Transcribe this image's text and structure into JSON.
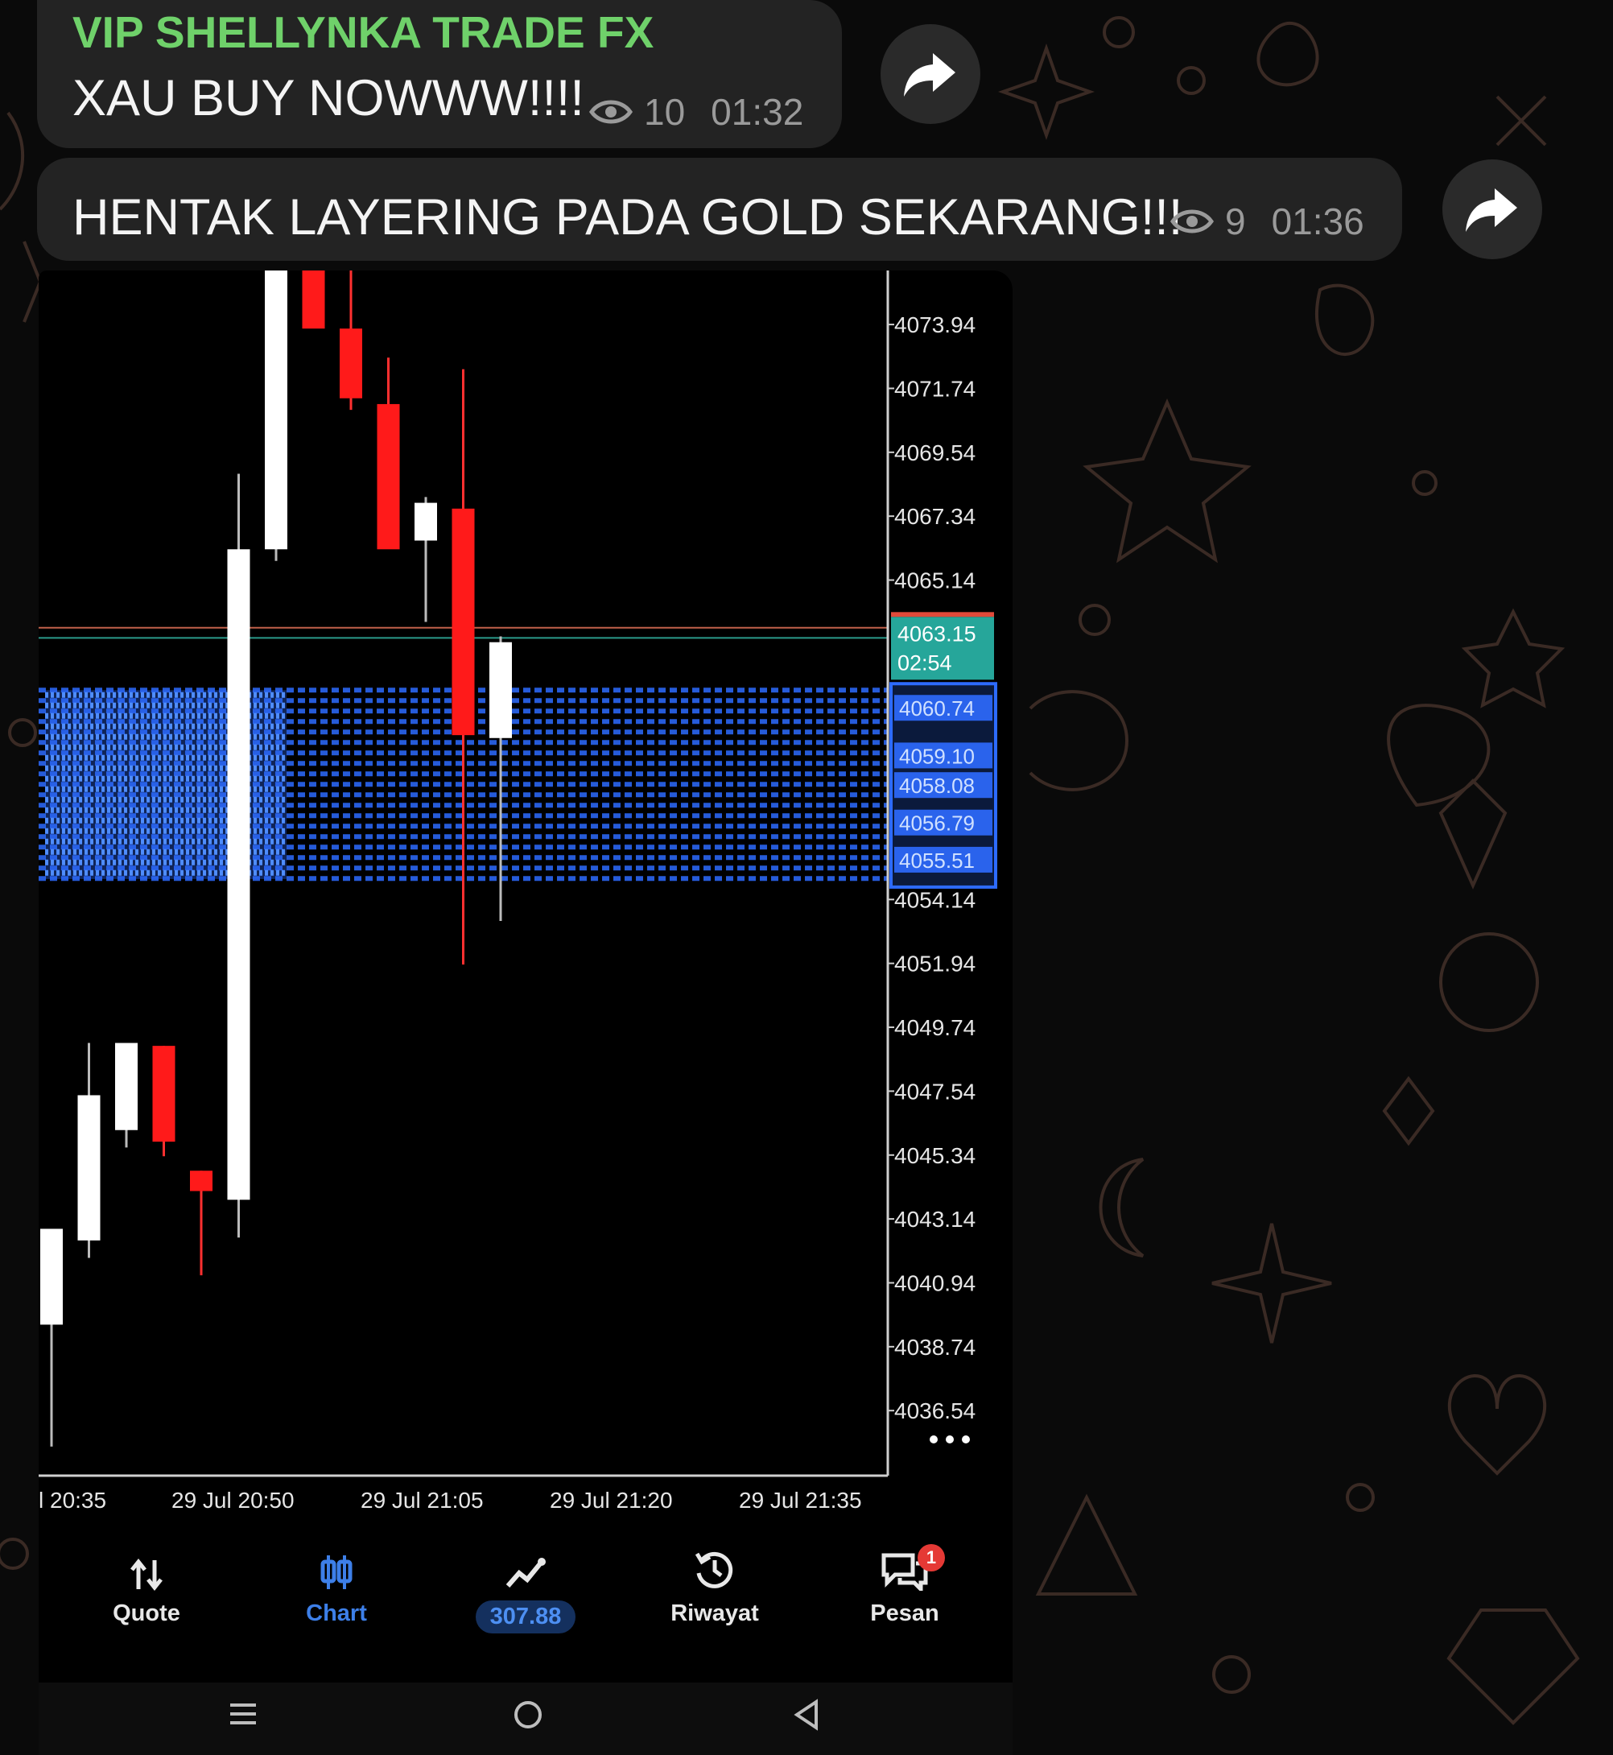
{
  "chat": {
    "messages": [
      {
        "sender": "VIP SHELLYNKA TRADE FX",
        "text": "XAU BUY NOWWW!!!!",
        "views": "10",
        "time": "01:32"
      },
      {
        "text": "HENTAK LAYERING PADA GOLD SEKARANG!!!",
        "views": "9",
        "time": "01:36"
      }
    ]
  },
  "chart_data": {
    "type": "candlestick",
    "y_ticks": [
      "4073.94",
      "4071.74",
      "4069.54",
      "4067.34",
      "4065.14",
      "4054.14",
      "4051.94",
      "4049.74",
      "4047.54",
      "4045.34",
      "4043.14",
      "4040.94",
      "4038.74",
      "4036.54"
    ],
    "y_range": [
      4034.3,
      4075.8
    ],
    "x_ticks": [
      "l 20:35",
      "29 Jul 20:50",
      "29 Jul 21:05",
      "29 Jul 21:20",
      "29 Jul 21:35"
    ],
    "price_tag": {
      "price": "4063.15",
      "countdown": "02:54",
      "value": 4063.15
    },
    "bid_line": 4063.5,
    "candles": [
      {
        "o": 4039.5,
        "h": 4041.8,
        "l": 4035.3,
        "c": 4042.8
      },
      {
        "o": 4042.4,
        "h": 4049.2,
        "l": 4041.8,
        "c": 4047.4
      },
      {
        "o": 4046.2,
        "h": 4048.6,
        "l": 4045.6,
        "c": 4049.2
      },
      {
        "o": 4049.1,
        "h": 4049.1,
        "l": 4045.3,
        "c": 4045.8
      },
      {
        "o": 4044.8,
        "h": 4044.8,
        "l": 4041.2,
        "c": 4044.1
      },
      {
        "o": 4043.8,
        "h": 4068.8,
        "l": 4042.5,
        "c": 4066.2
      },
      {
        "o": 4066.2,
        "h": 4079.0,
        "l": 4065.8,
        "c": 4078.0
      },
      {
        "o": 4077.0,
        "h": 4079.5,
        "l": 4074.8,
        "c": 4073.8
      },
      {
        "o": 4073.8,
        "h": 4076.5,
        "l": 4071.0,
        "c": 4071.4
      },
      {
        "o": 4071.2,
        "h": 4072.8,
        "l": 4067.0,
        "c": 4066.2
      },
      {
        "o": 4066.5,
        "h": 4068.0,
        "l": 4063.7,
        "c": 4067.8
      },
      {
        "o": 4067.6,
        "h": 4072.4,
        "l": 4051.9,
        "c": 4059.8
      },
      {
        "o": 4059.7,
        "h": 4063.2,
        "l": 4053.4,
        "c": 4063.0
      }
    ],
    "order_levels": [
      {
        "price": "4060.74",
        "value": 4060.74
      },
      {
        "price": "4059.10",
        "value": 4059.1
      },
      {
        "price": "4058.08",
        "value": 4058.08
      },
      {
        "price": "4056.79",
        "value": 4056.79
      },
      {
        "price": "4055.51",
        "value": 4055.51
      }
    ],
    "grid": false
  },
  "bottom_nav": [
    {
      "label": "Quote",
      "icon": "quote-arrows-icon"
    },
    {
      "label": "Chart",
      "icon": "candles-icon",
      "active": true
    },
    {
      "label": "307.88",
      "icon": "trade-line-icon",
      "pill": true
    },
    {
      "label": "Riwayat",
      "icon": "history-icon"
    },
    {
      "label": "Pesan",
      "icon": "messages-icon",
      "badge": "1"
    }
  ],
  "colors": {
    "bull": "#ffffff",
    "bear": "#ff1a1a",
    "order": "#2d6bff",
    "tag": "#26a69a",
    "sender": "#6fd16a"
  }
}
